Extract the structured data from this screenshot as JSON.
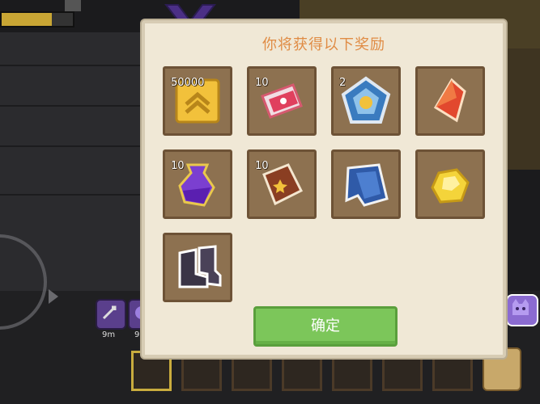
{
  "dialog": {
    "title": "你将获得以下奖励",
    "confirm_label": "确定",
    "rewards": [
      {
        "name": "rank-badge",
        "count": "50000"
      },
      {
        "name": "ticket",
        "count": "10"
      },
      {
        "name": "pentagon-medal",
        "count": "2"
      },
      {
        "name": "red-crystal",
        "count": ""
      },
      {
        "name": "purple-potion",
        "count": "10"
      },
      {
        "name": "book",
        "count": "10"
      },
      {
        "name": "blue-cloak",
        "count": ""
      },
      {
        "name": "gold-nugget",
        "count": ""
      },
      {
        "name": "boots",
        "count": ""
      }
    ]
  },
  "hud": {
    "skills": [
      {
        "distance": "9m"
      },
      {
        "distance": "9"
      }
    ]
  },
  "colors": {
    "dialog_bg": "#f0e8d6",
    "title": "#e08c45",
    "slot": "#8d7150",
    "confirm": "#7cc65a"
  }
}
